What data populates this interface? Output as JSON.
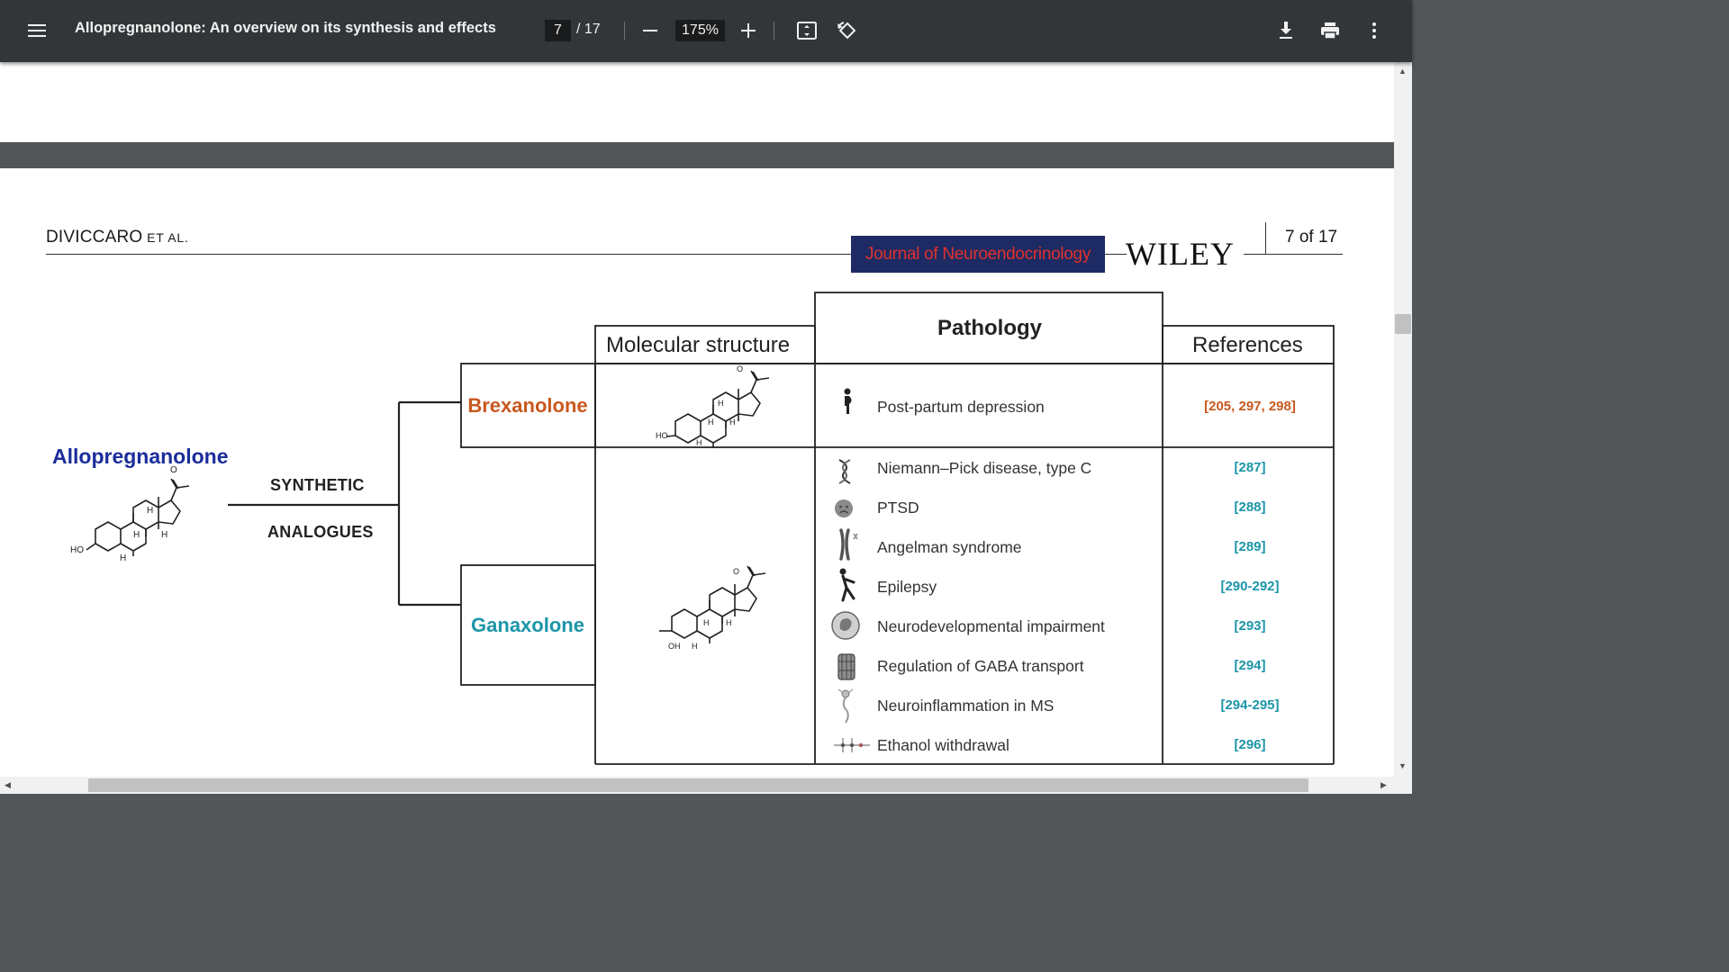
{
  "toolbar": {
    "title": "Allopregnanolone: An overview on its synthesis and effects",
    "page_current": "7",
    "page_total": "/ 17",
    "zoom": "175%",
    "icons": [
      "menu-icon",
      "zoom-out-icon",
      "zoom-in-icon",
      "fit-page-icon",
      "rotate-icon",
      "download-icon",
      "print-icon",
      "more-vert-icon"
    ]
  },
  "header": {
    "author": "DIVICCARO",
    "etal": " ET AL.",
    "journal": "Journal of Neuroendocrinology",
    "publisher": "WILEY",
    "page_of": "7 of 17"
  },
  "figure": {
    "parent_compound": "Allopregnanolone",
    "branch_label_1": "SYNTHETIC",
    "branch_label_2": "ANALOGUES",
    "columns": {
      "structure": "Molecular structure",
      "pathology": "Pathology",
      "references": "References"
    },
    "drugs": [
      {
        "name": "Brexanolone",
        "color": "#c8581f"
      },
      {
        "name": "Ganaxolone",
        "color": "#1c95a8"
      }
    ],
    "brexanolone_rows": [
      {
        "pathology": "Post-partum depression",
        "refs": "[205, 297, 298]",
        "icon": "pregnant-woman-icon"
      }
    ],
    "ganaxolone_rows": [
      {
        "pathology": "Niemann–Pick disease, type C",
        "refs": "[287]",
        "icon": "dna-icon"
      },
      {
        "pathology": "PTSD",
        "refs": "[288]",
        "icon": "sad-face-icon"
      },
      {
        "pathology": "Angelman syndrome",
        "refs": "[289]",
        "icon": "chromosome-icon"
      },
      {
        "pathology": "Epilepsy",
        "refs": "[290-292]",
        "icon": "falling-person-icon"
      },
      {
        "pathology": "Neurodevelopmental impairment",
        "refs": "[293]",
        "icon": "fetus-icon"
      },
      {
        "pathology": "Regulation of GABA transport",
        "refs": "[294]",
        "icon": "transporter-icon"
      },
      {
        "pathology": "Neuroinflammation in MS",
        "refs": "[294-295]",
        "icon": "neuron-icon"
      },
      {
        "pathology": "Ethanol withdrawal",
        "refs": "[296]",
        "icon": "ethanol-molecule-icon"
      }
    ],
    "structure_atoms": {
      "ho": "HO",
      "h": "H",
      "o": "O",
      "oh": "OH"
    }
  }
}
